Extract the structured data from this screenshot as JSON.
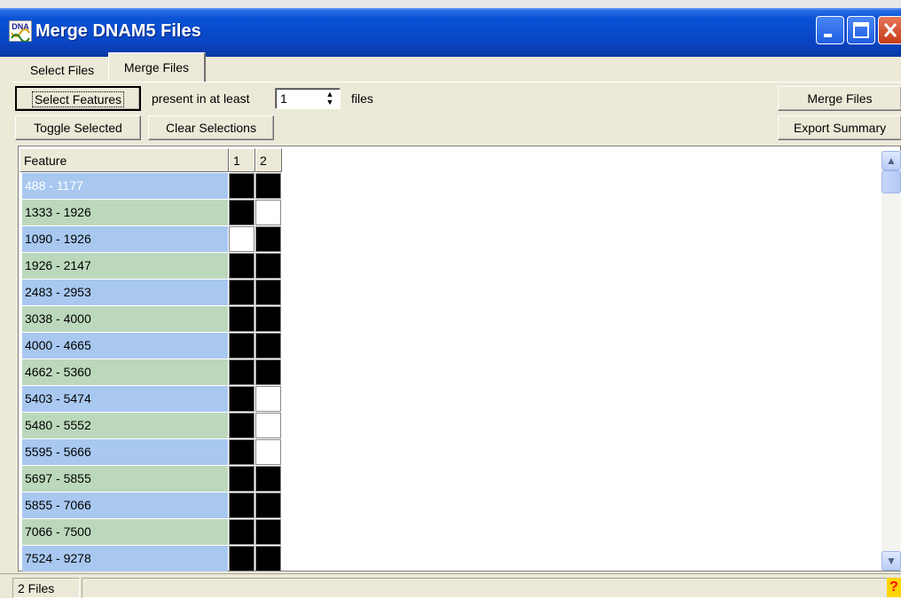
{
  "window": {
    "title": "Merge DNAM5 Files",
    "app_icon": "dna-app-icon",
    "app_icon_text": "DNA",
    "controls": [
      "minimize-icon",
      "maximize-icon",
      "close-icon"
    ]
  },
  "tabs": [
    {
      "label": "Select Files",
      "active": false
    },
    {
      "label": "Merge Files",
      "active": true
    }
  ],
  "toolbar": {
    "select_features_label": "Select Features",
    "present_label": "present in at least",
    "min_files_value": "1",
    "files_label": "files",
    "toggle_selected_label": "Toggle Selected",
    "clear_selections_label": "Clear Selections",
    "merge_files_label": "Merge Files",
    "export_summary_label": "Export Summary"
  },
  "grid": {
    "headers": {
      "feature": "Feature",
      "col1": "1",
      "col2": "2"
    },
    "rows": [
      {
        "feature": "488 - 1177",
        "f1": true,
        "f2": true,
        "selected": true
      },
      {
        "feature": "1333 - 1926",
        "f1": true,
        "f2": false
      },
      {
        "feature": "1090 - 1926",
        "f1": false,
        "f2": true
      },
      {
        "feature": "1926 - 2147",
        "f1": true,
        "f2": true
      },
      {
        "feature": "2483 - 2953",
        "f1": true,
        "f2": true
      },
      {
        "feature": "3038 - 4000",
        "f1": true,
        "f2": true
      },
      {
        "feature": "4000 - 4665",
        "f1": true,
        "f2": true
      },
      {
        "feature": "4662 - 5360",
        "f1": true,
        "f2": true
      },
      {
        "feature": "5403 - 5474",
        "f1": true,
        "f2": false
      },
      {
        "feature": "5480 - 5552",
        "f1": true,
        "f2": false
      },
      {
        "feature": "5595 - 5666",
        "f1": true,
        "f2": false
      },
      {
        "feature": "5697 - 5855",
        "f1": true,
        "f2": true
      },
      {
        "feature": "5855 - 7066",
        "f1": true,
        "f2": true
      },
      {
        "feature": "7066 - 7500",
        "f1": true,
        "f2": true
      },
      {
        "feature": "7524 - 9278",
        "f1": true,
        "f2": true
      }
    ],
    "row_colors": {
      "blue": "#a8c8f0",
      "green": "#bcd8bc",
      "present": "#000000",
      "absent": "#ffffff"
    },
    "scroll_icons": {
      "up": "▲",
      "down": "▼"
    }
  },
  "status": {
    "files": "2 Files",
    "help_icon": "?"
  }
}
